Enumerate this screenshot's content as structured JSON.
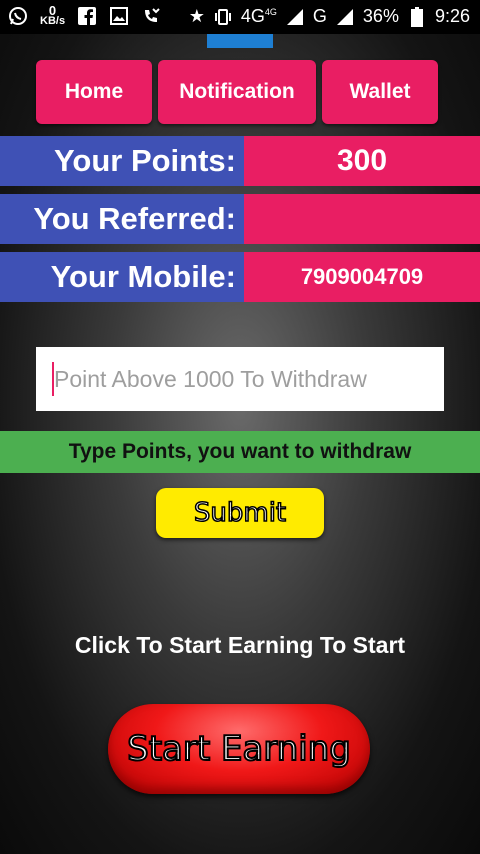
{
  "status_bar": {
    "kbs_value": "0",
    "kbs_unit": "KB/s",
    "network": "4G",
    "network_small": "4G",
    "network2": "G",
    "battery": "36%",
    "time": "9:26"
  },
  "nav": {
    "home": "Home",
    "notification": "Notification",
    "wallet": "Wallet"
  },
  "info": {
    "points_label": "Your Points:",
    "points_value": "300",
    "referred_label": "You Referred:",
    "referred_value": "",
    "mobile_label": "Your Mobile:",
    "mobile_value": "7909004709"
  },
  "withdraw": {
    "placeholder": "Point Above 1000 To Withdraw",
    "hint": "Type Points, you want to withdraw",
    "submit": "Submit"
  },
  "earn": {
    "text": "Click To Start Earning To Start",
    "button": "Start Earning"
  },
  "colors": {
    "nav_pink": "#e91e63",
    "label_blue": "#3f51b5",
    "hint_green": "#4caf50",
    "submit_yellow": "#ffeb00",
    "start_red": "#f01818"
  }
}
